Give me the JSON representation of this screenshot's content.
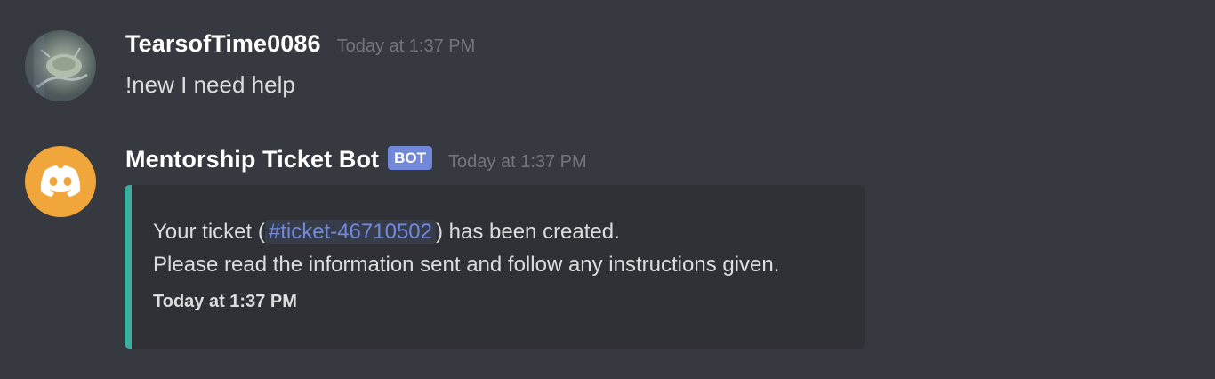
{
  "messages": [
    {
      "username": "TearsofTime0086",
      "timestamp": "Today at 1:37 PM",
      "content": "!new I need help"
    },
    {
      "username": "Mentorship Ticket Bot",
      "bot_tag": "BOT",
      "timestamp": "Today at 1:37 PM",
      "embed": {
        "desc_prefix": "Your ticket (",
        "channel_mention": "#ticket-46710502",
        "desc_suffix": ") has been created.",
        "desc_line2": "Please read the information sent and follow any instructions given.",
        "footer": "Today at 1:37 PM",
        "accent_color": "#3aaf9e"
      }
    }
  ],
  "colors": {
    "background": "#36393f",
    "embed_background": "#2f3136",
    "bot_tag": "#7289da",
    "mention": "#7289da",
    "bot_avatar": "#f0a63a"
  },
  "icons": {
    "user_avatar": "user-avatar-photo",
    "bot_avatar": "discord-logo-icon"
  }
}
